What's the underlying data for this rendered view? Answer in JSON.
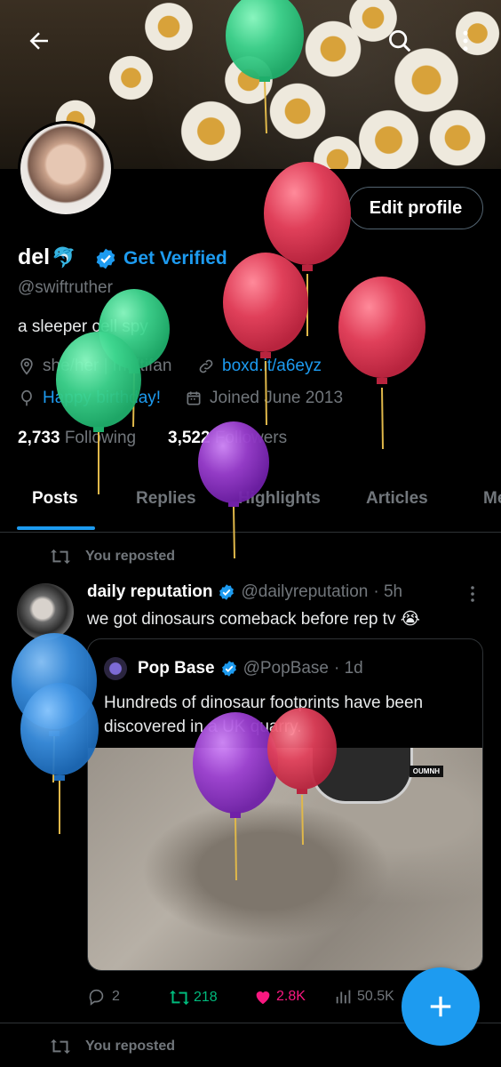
{
  "header": {
    "back_icon": "arrow-left-icon",
    "search_icon": "search-icon",
    "more_icon": "more-vertical-icon"
  },
  "profile": {
    "display_name": "del",
    "name_emoji": "🐬",
    "get_verified": "Get Verified",
    "handle": "@swiftruther",
    "bio": "a sleeper cell spy",
    "pronouns": "she/her | multifan",
    "website": "boxd.it/a6eyz",
    "birthday": "Happy birthday!",
    "joined": "Joined June 2013",
    "following_count": "2,733",
    "following_label": "Following",
    "followers_count": "3,522",
    "followers_label": "Followers",
    "edit_profile": "Edit profile"
  },
  "tabs": [
    {
      "label": "Posts",
      "active": true
    },
    {
      "label": "Replies"
    },
    {
      "label": "Highlights"
    },
    {
      "label": "Articles"
    },
    {
      "label": "Me"
    }
  ],
  "post1": {
    "repost_label": "You reposted",
    "author_name": "daily reputation",
    "author_handle": "@dailyreputation",
    "time": "· 5h",
    "text": "we got dinosaurs comeback before rep tv 😭",
    "quote": {
      "author_name": "Pop Base",
      "author_handle": "@PopBase",
      "time": "· 1d",
      "text": "Hundreds of dinosaur footprints have been discovered in a UK quarry.",
      "watermark": "OUMNH"
    },
    "stats": {
      "replies": "2",
      "reposts": "218",
      "likes": "2.8K",
      "views": "50.5K"
    }
  },
  "post2": {
    "repost_label": "You reposted"
  },
  "colors": {
    "accent": "#1d9bf0",
    "repost": "#00ba7c",
    "like": "#f91880",
    "balloon_red": "#e0405a",
    "balloon_green": "#3ed68f",
    "balloon_purple": "#9b3fd0",
    "balloon_blue": "#3a8fe0"
  }
}
